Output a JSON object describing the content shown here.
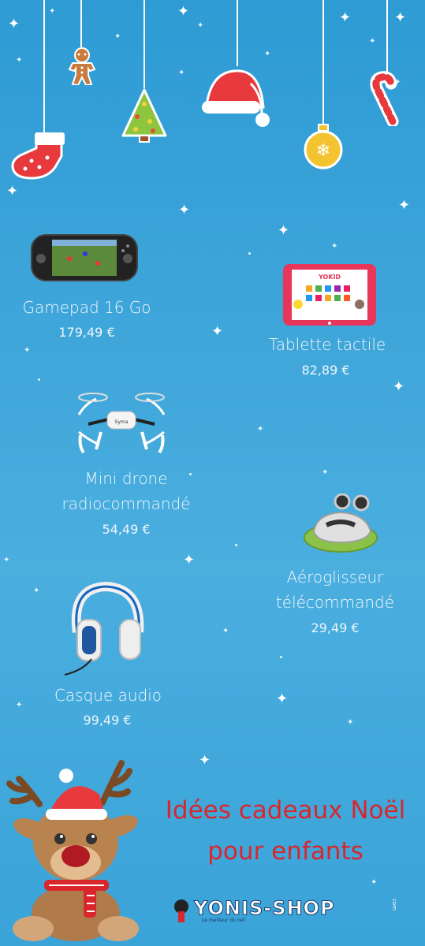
{
  "products": [
    {
      "name": "Gamepad 16 Go",
      "price": "179,49 €",
      "icon": "gamepad-tablet-icon"
    },
    {
      "name": "Tablette tactile",
      "price": "82,89 €",
      "icon": "tablet-icon"
    },
    {
      "name_line1": "Mini drone",
      "name_line2": "radiocommandé",
      "price": "54,49 €",
      "icon": "drone-icon"
    },
    {
      "name_line1": "Aéroglisseur",
      "name_line2": "télécommandé",
      "price": "29,49 €",
      "icon": "hovercraft-icon"
    },
    {
      "name": "Casque audio",
      "price": "99,49 €",
      "icon": "headphones-icon"
    }
  ],
  "headline": {
    "line1": "Idées cadeaux Noël",
    "line2": "pour enfants",
    "color": "#d9262c"
  },
  "logo": {
    "text": "YONIS-SHOP",
    "tagline": "Le meilleur du net",
    "suffix": "com"
  },
  "tablet_brand": "YOKID",
  "drone_label": "Syma",
  "colors": {
    "background": "#3fa6da",
    "accent_red": "#d9262c"
  }
}
